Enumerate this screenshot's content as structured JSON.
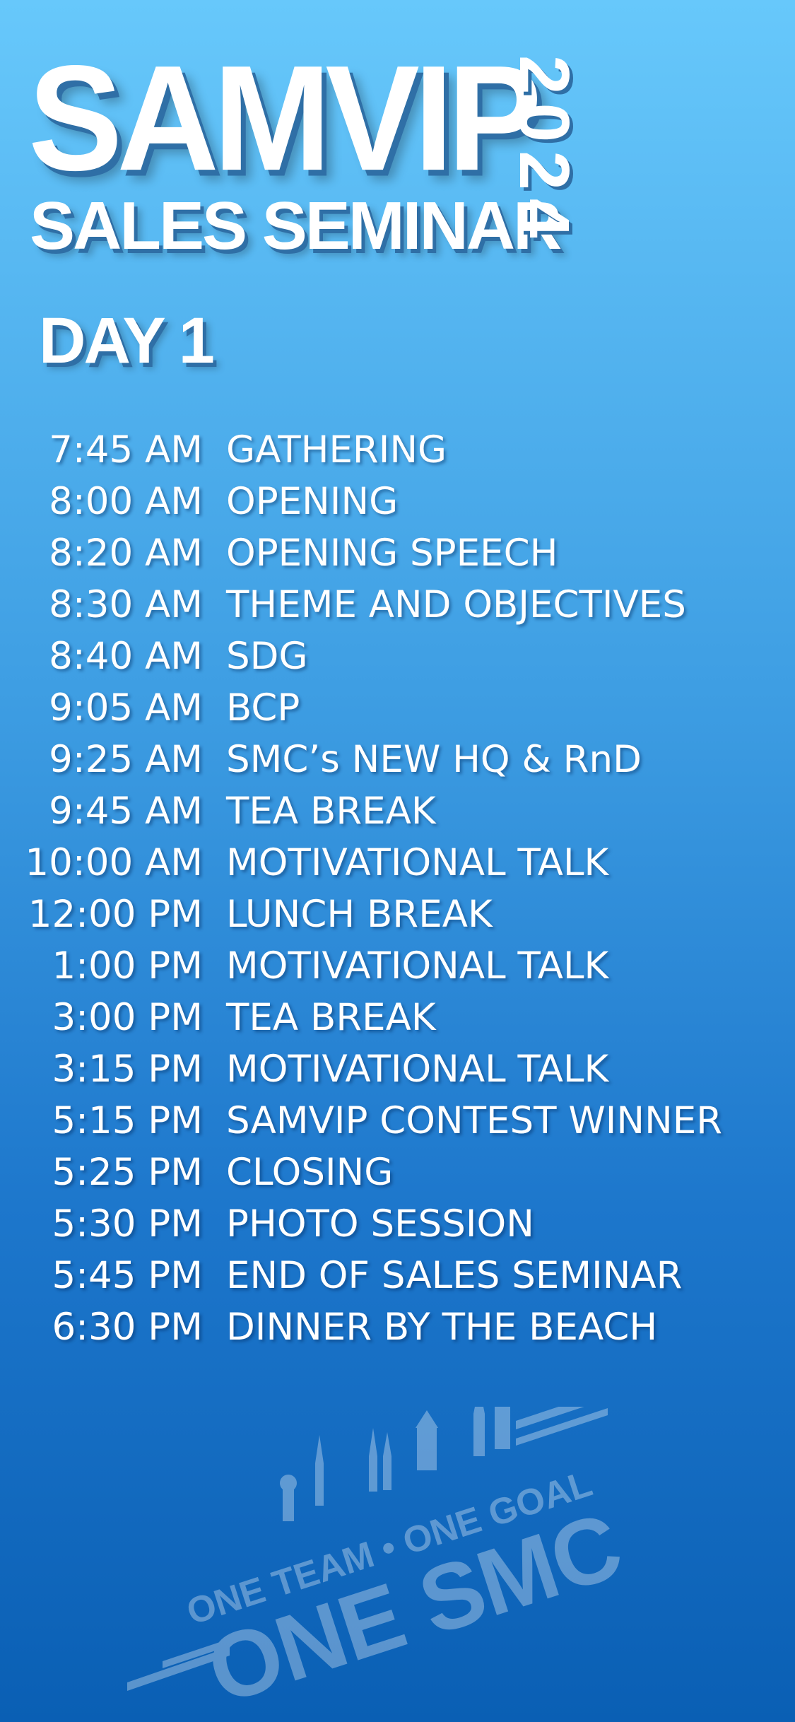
{
  "header": {
    "title": "SAMVIP",
    "subtitle": "SALES SEMINAR",
    "year": "2024"
  },
  "day_label": "DAY 1",
  "schedule": [
    {
      "time": "7:45 AM",
      "event": "GATHERING"
    },
    {
      "time": "8:00 AM",
      "event": "OPENING"
    },
    {
      "time": "8:20 AM",
      "event": "OPENING SPEECH"
    },
    {
      "time": "8:30 AM",
      "event": "THEME AND OBJECTIVES"
    },
    {
      "time": "8:40 AM",
      "event": "SDG"
    },
    {
      "time": "9:05 AM",
      "event": "BCP"
    },
    {
      "time": "9:25 AM",
      "event": "SMC’s NEW HQ & RnD"
    },
    {
      "time": "9:45 AM",
      "event": "TEA BREAK"
    },
    {
      "time": "10:00 AM",
      "event": "MOTIVATIONAL TALK"
    },
    {
      "time": "12:00 PM",
      "event": "LUNCH BREAK"
    },
    {
      "time": "1:00 PM",
      "event": "MOTIVATIONAL TALK"
    },
    {
      "time": "3:00 PM",
      "event": "TEA BREAK"
    },
    {
      "time": "3:15 PM",
      "event": "MOTIVATIONAL TALK"
    },
    {
      "time": "5:15 PM",
      "event": "SAMVIP CONTEST WINNER"
    },
    {
      "time": "5:25 PM",
      "event": "CLOSING"
    },
    {
      "time": "5:30 PM",
      "event": "PHOTO SESSION"
    },
    {
      "time": "5:45 PM",
      "event": "END OF SALES SEMINAR"
    },
    {
      "time": "6:30 PM",
      "event": "DINNER BY THE BEACH"
    }
  ],
  "logo": {
    "line1": "ONE TEAM • ONE GOAL",
    "line2": "ONE SMC"
  },
  "colors": {
    "background_top": "#67c8fb",
    "background_bottom": "#0a5fb4",
    "text": "#ffffff",
    "shadow": "#2f6fa6"
  }
}
